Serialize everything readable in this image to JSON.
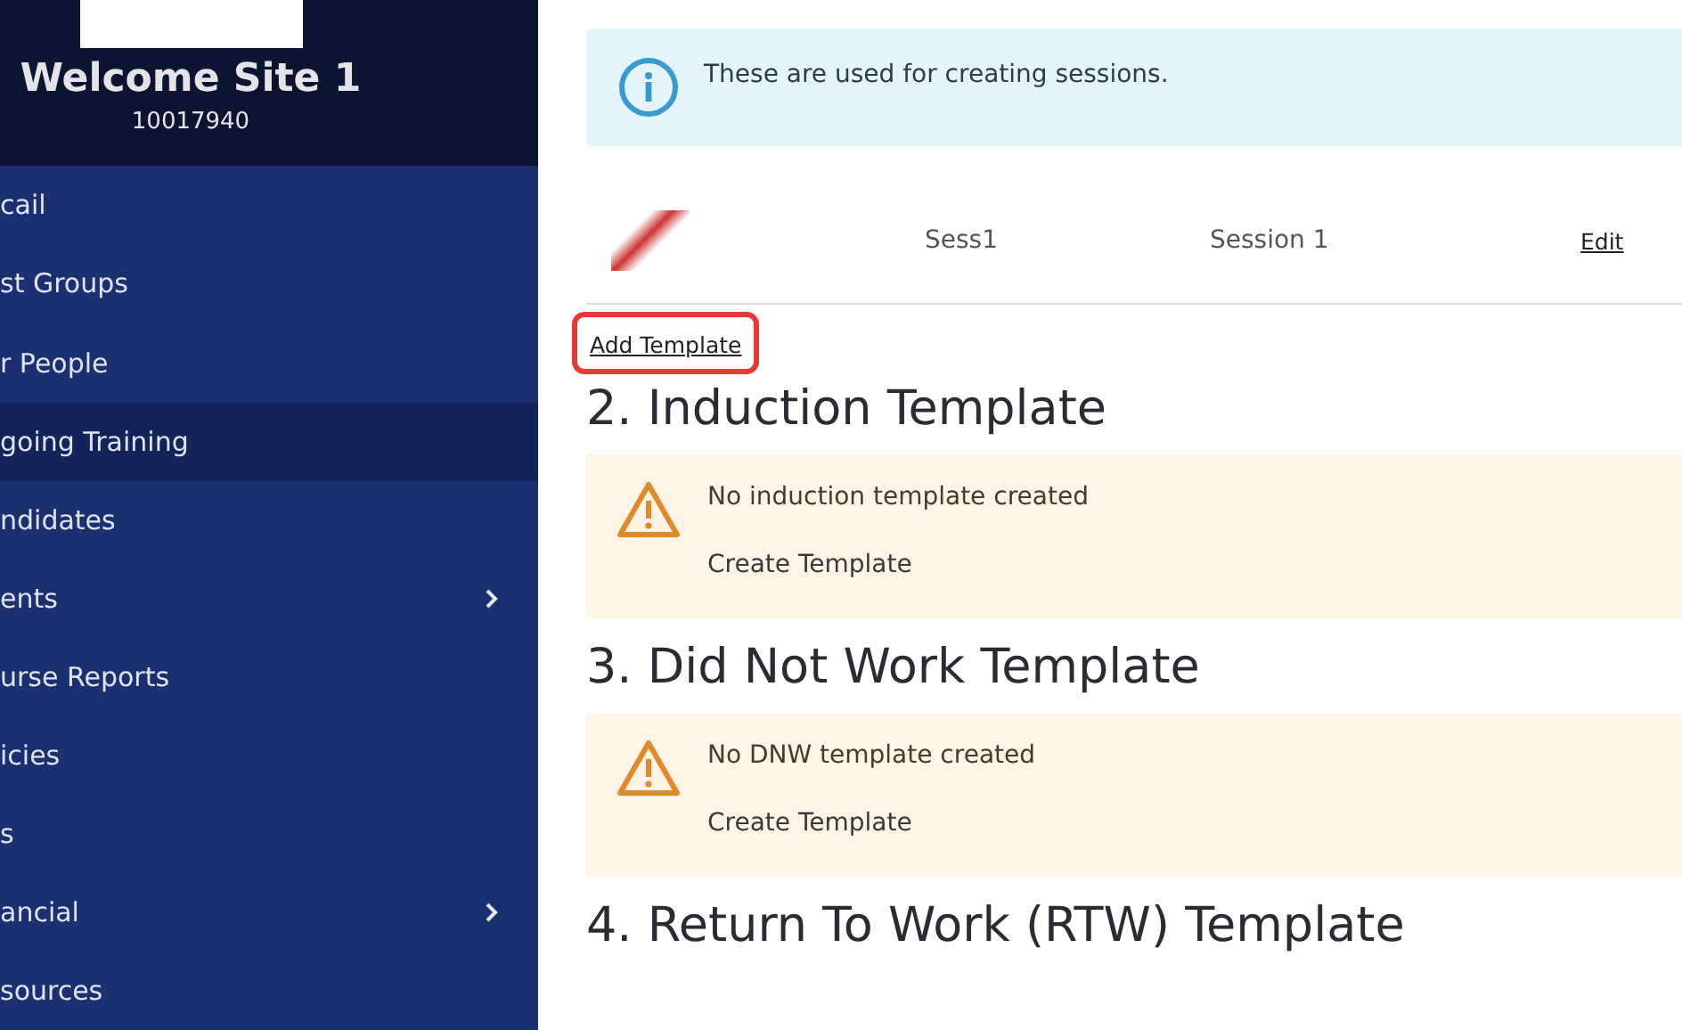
{
  "sidebar": {
    "title": "Welcome Site 1",
    "site_number": "10017940",
    "items": [
      {
        "label": "cail",
        "selected": false,
        "submenu": false
      },
      {
        "label": "st Groups",
        "selected": false,
        "submenu": false
      },
      {
        "label": "r People",
        "selected": false,
        "submenu": false
      },
      {
        "label": "going Training",
        "selected": true,
        "submenu": false
      },
      {
        "label": "ndidates",
        "selected": false,
        "submenu": false
      },
      {
        "label": "ents",
        "selected": false,
        "submenu": true
      },
      {
        "label": "urse Reports",
        "selected": false,
        "submenu": false
      },
      {
        "label": "icies",
        "selected": false,
        "submenu": false
      },
      {
        "label": "s",
        "selected": false,
        "submenu": false
      },
      {
        "label": "ancial",
        "selected": false,
        "submenu": true
      },
      {
        "label": "sources",
        "selected": false,
        "submenu": false
      }
    ]
  },
  "info": {
    "text": "These are used for creating sessions."
  },
  "templates": [
    {
      "code": "Sess1",
      "name": "Session 1",
      "action": "Edit"
    }
  ],
  "add_link": {
    "label": "Add Template",
    "highlighted": true
  },
  "sections": [
    {
      "title": "2. Induction Template",
      "warning": "No induction template created",
      "action": "Create Template"
    },
    {
      "title": "3. Did Not Work Template",
      "warning": "No DNW template created",
      "action": "Create Template"
    },
    {
      "title": "4. Return To Work (RTW) Template"
    }
  ]
}
